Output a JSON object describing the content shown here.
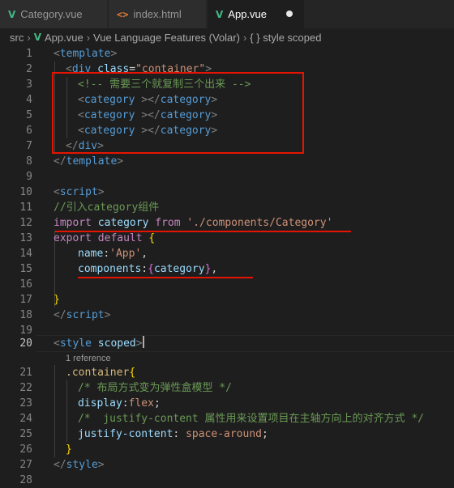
{
  "tabs": [
    {
      "label": "Category.vue",
      "icon": "vue-icon",
      "glyph": "V"
    },
    {
      "label": "index.html",
      "icon": "html-icon",
      "glyph": "<>"
    },
    {
      "label": "App.vue",
      "icon": "vue-icon",
      "glyph": "V",
      "active": true,
      "dirty": true
    }
  ],
  "breadcrumb": {
    "folder": "src",
    "file": "App.vue",
    "language": "Vue Language Features (Volar)",
    "symbol": "{ } style scoped"
  },
  "code_lens": "1 reference",
  "current_line": "20",
  "lines": [
    {
      "n": "1"
    },
    {
      "n": "2"
    },
    {
      "n": "3"
    },
    {
      "n": "4"
    },
    {
      "n": "5"
    },
    {
      "n": "6"
    },
    {
      "n": "7"
    },
    {
      "n": "8"
    },
    {
      "n": "9"
    },
    {
      "n": "10"
    },
    {
      "n": "11"
    },
    {
      "n": "12"
    },
    {
      "n": "13"
    },
    {
      "n": "14"
    },
    {
      "n": "15"
    },
    {
      "n": "16"
    },
    {
      "n": "17"
    },
    {
      "n": "18"
    },
    {
      "n": "19"
    },
    {
      "n": "20"
    },
    {
      "n": "21"
    },
    {
      "n": "22"
    },
    {
      "n": "23"
    },
    {
      "n": "24"
    },
    {
      "n": "25"
    },
    {
      "n": "26"
    },
    {
      "n": "27"
    },
    {
      "n": "28"
    }
  ],
  "code": {
    "l1": [
      "<",
      "template",
      ">"
    ],
    "l2": [
      "<",
      "div",
      " ",
      "class",
      "=",
      "\"container\"",
      ">"
    ],
    "l3": "<!-- 需要三个就复制三个出来 -->",
    "l4": [
      "<",
      "category",
      " ",
      "></",
      "category",
      ">"
    ],
    "l5": [
      "<",
      "category",
      " ",
      "></",
      "category",
      ">"
    ],
    "l6": [
      "<",
      "category",
      " ",
      "></",
      "category",
      ">"
    ],
    "l7": [
      "</",
      "div",
      ">"
    ],
    "l8": [
      "</",
      "template",
      ">"
    ],
    "l10": [
      "<",
      "script",
      ">"
    ],
    "l11": "//引入category组件",
    "l12": [
      "import",
      " ",
      "category",
      " ",
      "from",
      " ",
      "'./components/Category'"
    ],
    "l13": [
      "export",
      " ",
      "default",
      " ",
      "{"
    ],
    "l14": [
      "name",
      ":",
      "'App'",
      ","
    ],
    "l15": [
      "components",
      ":",
      "{",
      "category",
      "}",
      ","
    ],
    "l17": "}",
    "l18": [
      "</",
      "script",
      ">"
    ],
    "l20": [
      "<",
      "style",
      " ",
      "scoped",
      ">"
    ],
    "l21": [
      ".container",
      "{"
    ],
    "l22": "/* 布局方式变为弹性盒模型 */",
    "l23": [
      "display",
      ":",
      "flex",
      ";"
    ],
    "l24": "/*  justify-content 属性用来设置项目在主轴方向上的对齐方式 */",
    "l25": [
      "justify-content",
      ": ",
      "space-around",
      ";"
    ],
    "l26": "}",
    "l27": [
      "</",
      "style",
      ">"
    ]
  },
  "colors": {
    "background": "#1e1e1e",
    "annotation": "#e51400",
    "vue": "#41b883",
    "html": "#e37933"
  }
}
